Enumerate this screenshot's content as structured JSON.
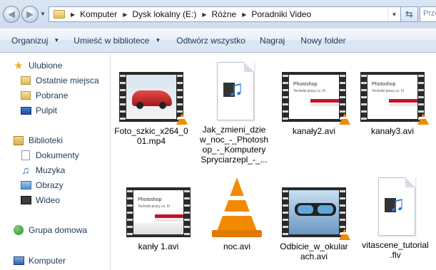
{
  "address_bar": {
    "crumbs": [
      "Komputer",
      "Dysk lokalny (E:)",
      "Różne",
      "Poradniki Video"
    ],
    "search_placeholder": "Przeszukaj"
  },
  "toolbar": {
    "organize": "Organizuj",
    "include_library": "Umieść w bibliotece",
    "play_all": "Odtwórz wszystko",
    "burn": "Nagraj",
    "new_folder": "Nowy folder"
  },
  "sidebar": {
    "favorites": "Ulubione",
    "favorites_items": [
      "Ostatnie miejsca",
      "Pobrane",
      "Pulpit"
    ],
    "libraries": "Biblioteki",
    "libraries_items": [
      "Dokumenty",
      "Muzyka",
      "Obrazy",
      "Wideo"
    ],
    "homegroup": "Grupa domowa",
    "computer": "Komputer"
  },
  "files": [
    {
      "name": "Foto_szkic_x264_001.mp4",
      "label_lines": [
        "Foto_szkic_x264_0",
        "01.mp4"
      ],
      "kind": "video-car"
    },
    {
      "name": "Jak_zmieni_dzie_w_noc_-_Photoshop_-_Komputery Spryciarzepl_-_...",
      "label_lines": [
        "Jak_zmieni_dzie",
        "w_noc_-_Photosh",
        "op_-_Komputery",
        "Spryciarzepl_-_..."
      ],
      "kind": "media-doc"
    },
    {
      "name": "kanały2.avi",
      "label_lines": [
        "kanały2.avi"
      ],
      "kind": "video-ps"
    },
    {
      "name": "kanały3.avi",
      "label_lines": [
        "kanały3.avi"
      ],
      "kind": "video-ps"
    },
    {
      "name": "kanły 1.avi",
      "label_lines": [
        "kanły 1.avi"
      ],
      "kind": "video-ps"
    },
    {
      "name": "noc.avi",
      "label_lines": [
        "noc.avi"
      ],
      "kind": "vlc"
    },
    {
      "name": "Odbicie_w_okularach.avi",
      "label_lines": [
        "Odbicie_w_okular",
        "ach.avi"
      ],
      "kind": "video-glasses"
    },
    {
      "name": "vitascene_tutorial.flv",
      "label_lines": [
        "vitascene_tutorial",
        ".flv"
      ],
      "kind": "media-doc"
    }
  ],
  "slide_text": {
    "title": "Photoshop",
    "subtitle": "Techniki pracy cz. III"
  },
  "colors": {
    "toolbar_text": "#1e395b",
    "vlc_orange": "#f28a00",
    "accent_red": "#c8102e"
  }
}
